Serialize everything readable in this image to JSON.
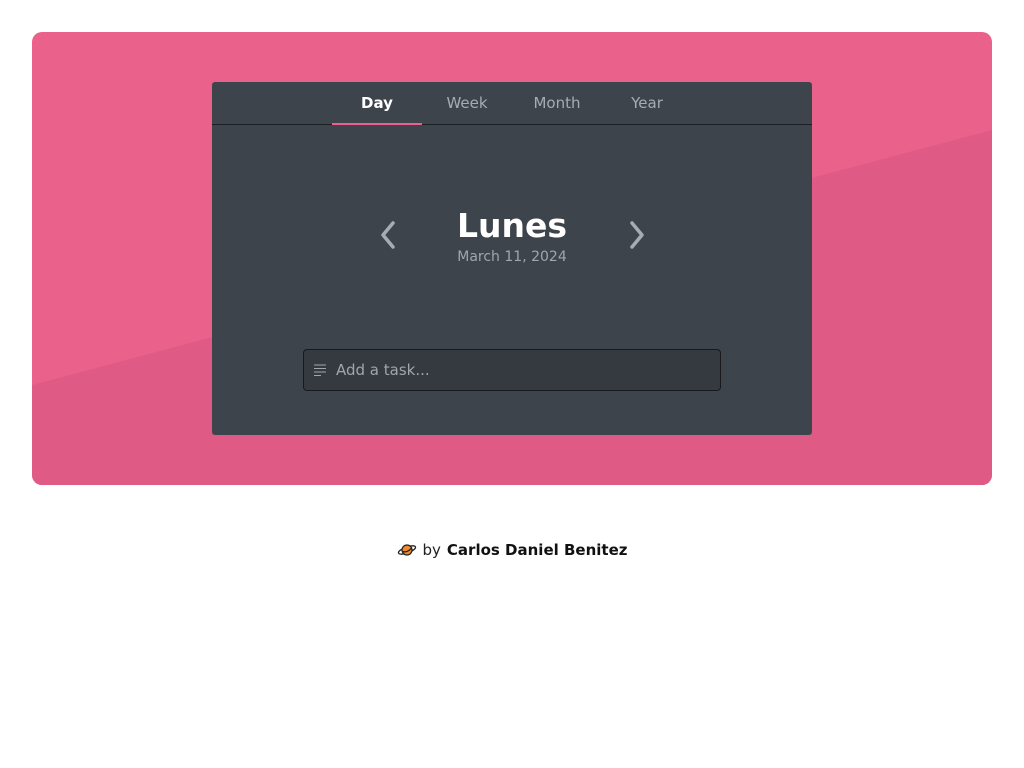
{
  "tabs": [
    {
      "label": "Day",
      "active": true
    },
    {
      "label": "Week",
      "active": false
    },
    {
      "label": "Month",
      "active": false
    },
    {
      "label": "Year",
      "active": false
    }
  ],
  "day_view": {
    "title": "Lunes",
    "date": "March 11, 2024",
    "prev_icon": "chevron-left-icon",
    "next_icon": "chevron-right-icon"
  },
  "task_input": {
    "placeholder": "Add a task...",
    "value": "",
    "icon": "text-lines-icon"
  },
  "footer": {
    "icon": "planet-icon",
    "by_text": "by",
    "author": "Carlos Daniel Benitez"
  },
  "colors": {
    "background_accent": "#ea618b",
    "card_background": "#3e444c",
    "active_tab_underline": "#ea618b"
  }
}
